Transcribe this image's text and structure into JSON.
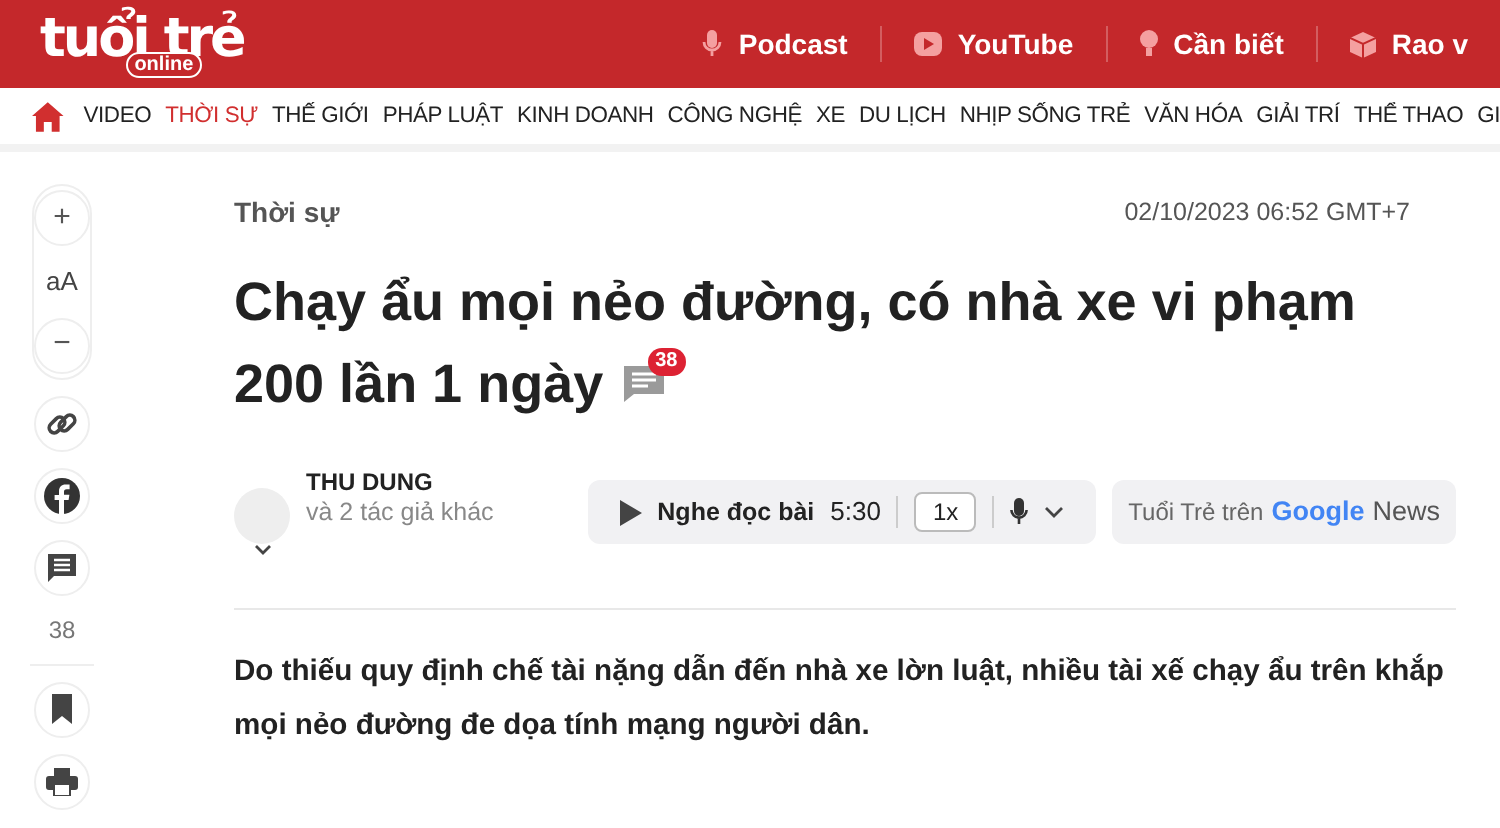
{
  "header": {
    "logo": {
      "main": "tuổi trẻ",
      "sub": "online"
    },
    "links": [
      {
        "label": "Podcast"
      },
      {
        "label": "YouTube"
      },
      {
        "label": "Cần biết"
      },
      {
        "label": "Rao v"
      }
    ]
  },
  "nav": [
    {
      "label": "VIDEO",
      "selected": false
    },
    {
      "label": "THỜI SỰ",
      "selected": true
    },
    {
      "label": "THẾ GIỚI",
      "selected": false
    },
    {
      "label": "PHÁP LUẬT",
      "selected": false
    },
    {
      "label": "KINH DOANH",
      "selected": false
    },
    {
      "label": "CÔNG NGHỆ",
      "selected": false
    },
    {
      "label": "XE",
      "selected": false
    },
    {
      "label": "DU LỊCH",
      "selected": false
    },
    {
      "label": "NHỊP SỐNG TRẺ",
      "selected": false
    },
    {
      "label": "VĂN HÓA",
      "selected": false
    },
    {
      "label": "GIẢI TRÍ",
      "selected": false
    },
    {
      "label": "THỂ THAO",
      "selected": false
    },
    {
      "label": "GI",
      "selected": false
    }
  ],
  "sidebar": {
    "zoom": {
      "plus": "+",
      "font": "aA",
      "minus": "−"
    },
    "comment_count": "38"
  },
  "article": {
    "category": "Thời sự",
    "date": "02/10/2023 06:52 GMT+7",
    "title_lines": [
      "Chạy ẩu mọi nẻo đường, có nhà xe vi phạm",
      "200 lần 1 ngày"
    ],
    "comment_badge": "38",
    "author": {
      "name": "THU DUNG",
      "others": "và 2 tác giả khác"
    },
    "audio": {
      "label": "Nghe đọc bài",
      "duration": "5:30",
      "speed": "1x"
    },
    "google_news": {
      "prefix": "Tuổi Trẻ trên",
      "brand": "Google",
      "suffix": "News"
    },
    "lead": "Do thiếu quy định chế tài nặng dẫn đến nhà xe lờn luật, nhiều tài xế chạy ẩu trên khắp mọi nẻo đường đe dọa tính mạng người dân."
  }
}
